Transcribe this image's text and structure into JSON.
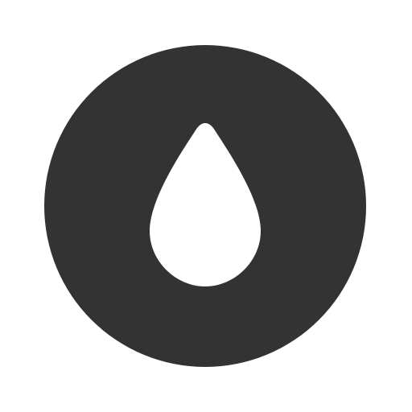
{
  "icon": {
    "name": "water-drop-icon",
    "colors": {
      "circle": "#333333",
      "drop": "#ffffff",
      "background": "#ffffff"
    }
  }
}
